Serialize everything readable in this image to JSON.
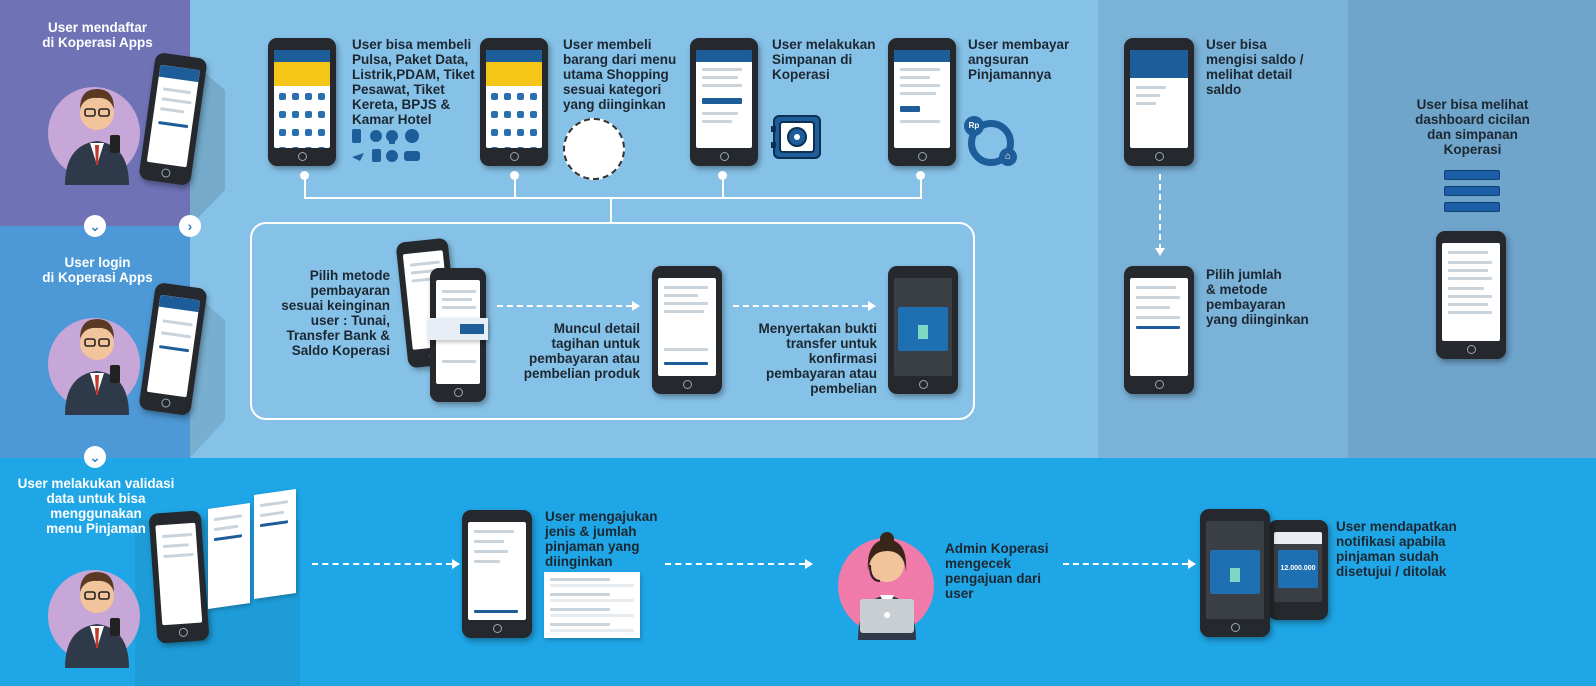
{
  "steps": {
    "register": "User mendaftar\ndi Koperasi Apps",
    "login": "User login\ndi Koperasi Apps",
    "validate": "User melakukan validasi\ndata untuk bisa\nmenggunakan\nmenu Pinjaman",
    "buy_ppob": "User bisa membeli\nPulsa, Paket Data,\nListrik,PDAM, Tiket\nPesawat, Tiket\nKereta, BPJS &\nKamar Hotel",
    "shopping": "User membeli\nbarang dari menu\nutama Shopping\nsesuai kategori\nyang diinginkan",
    "savings": "User melakukan\nSimpanan di\nKoperasi",
    "installment": "User membayar\nangsuran\nPinjamannya",
    "payment_method": "Pilih metode\npembayaran\nsesuai keinginan\nuser : Tunai,\nTransfer Bank &\nSaldo Koperasi",
    "bill_detail": "Muncul detail\ntagihan untuk\npembayaran atau\npembelian produk",
    "transfer_proof": "Menyertakan bukti\ntransfer untuk\nkonfirmasi\npembayaran atau\npembelian",
    "topup": "User bisa\nmengisi saldo /\nmelihat detail\nsaldo",
    "topup_method": "Pilih jumlah\n& metode\npembayaran\nyang diinginkan",
    "dashboard": "User bisa melihat\ndashboard cicilan\ndan simpanan\nKoperasi",
    "loan_request": "User mengajukan\njenis & jumlah\npinjaman yang\ndiinginkan",
    "admin_check": "Admin Koperasi\nmengecek\npengajuan dari\nuser",
    "notification": "User mendapatkan\nnotifikasi apabila\npinjaman sudah\ndisetujui / ditolak"
  },
  "screen_text": {
    "loan_amount": "12.000.000",
    "rp_badge": "Rp"
  },
  "colors": {
    "panel_purple": "#6f73b6",
    "panel_mid": "#4d98d6",
    "panel_light": "#86c2e8",
    "panel_right1": "#7ab2d8",
    "panel_right2": "#6fa4cb",
    "bottom": "#1fa6e6",
    "accent_blue": "#1d5d9a",
    "yellow": "#f5c518"
  }
}
